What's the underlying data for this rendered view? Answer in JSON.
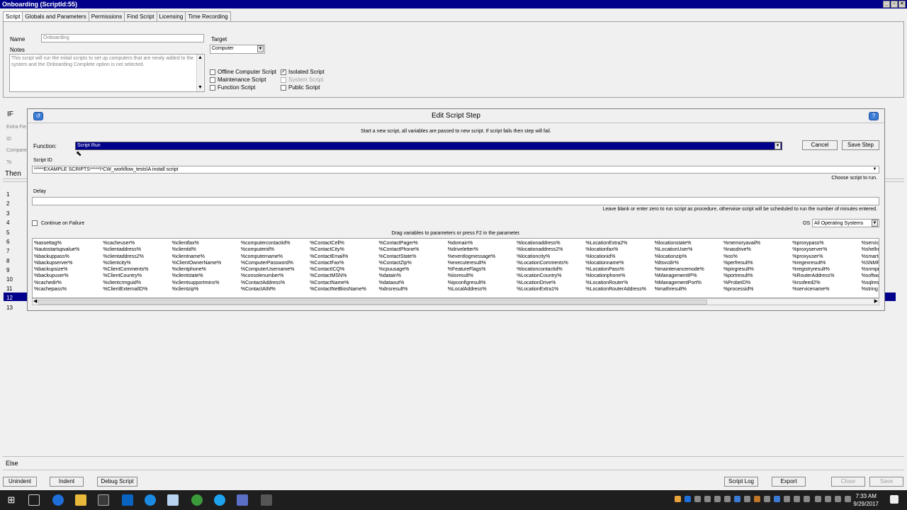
{
  "window": {
    "title": "Onboarding  (ScriptId:55)"
  },
  "tabs": [
    "Script",
    "Globals and Parameters",
    "Permissions",
    "Find Script",
    "Licensing",
    "Time Recording"
  ],
  "script_form": {
    "name_label": "Name",
    "name_value": "Onboarding",
    "notes_label": "Notes",
    "notes_value": "This script will run the initial scripts to set up computers that are newly added to the system and the Onboarding Complete option is not selected.",
    "target_label": "Target",
    "target_value": "Computer",
    "checks": [
      {
        "label": "Offline Computer Script",
        "checked": false,
        "disabled": false
      },
      {
        "label": "Maintenance Script",
        "checked": false,
        "disabled": false
      },
      {
        "label": "Function Script",
        "checked": false,
        "disabled": false
      },
      {
        "label": "Isolated Script",
        "checked": true,
        "disabled": false
      },
      {
        "label": "System Script",
        "checked": false,
        "disabled": true
      },
      {
        "label": "Public Script",
        "checked": false,
        "disabled": false
      }
    ]
  },
  "side": {
    "if_label": "IF",
    "extra_field": "Extra Fie",
    "id_label": "ID",
    "compare_label": "Compare",
    "to_label": "To",
    "then_label": "Then",
    "else_label": "Else",
    "row_numbers": [
      "1",
      "2",
      "3",
      "4",
      "5",
      "6",
      "7",
      "8",
      "9",
      "10",
      "11",
      "12",
      "13"
    ]
  },
  "dialog": {
    "title": "Edit Script Step",
    "description": "Start a new script, all variables are passed to new script. If script fails then step will fail.",
    "function_label": "Function:",
    "function_value": "Script Run",
    "cancel_label": "Cancel",
    "save_step_label": "Save Step",
    "script_id_label": "Script ID",
    "script_id_value": "*****EXAMPLE SCRIPTS*****\\*CW_workflow_tests\\A install script",
    "choose_hint": "Choose script to run.",
    "delay_label": "Delay",
    "delay_value": "",
    "delay_hint": "Leave blank or enter zero to run script as procedure, otherwise script will be scheduled to run the number of minutes entered.",
    "continue_label": "Continue on Failure",
    "os_label": "OS",
    "os_value": "All Operating Systems",
    "drag_hint": "Drag variables to parameters or press F2 in the parameter.",
    "variables": [
      [
        "%assettag%",
        "%autostartupvalue%",
        "%backuppass%",
        "%backupserver%",
        "%backupsize%",
        "%backupuser%",
        "%cachedir%",
        "%cachepass%"
      ],
      [
        "%cacheuser%",
        "%clientaddress%",
        "%clientaddress2%",
        "%clientcity%",
        "%ClientComments%",
        "%ClientCountry%",
        "%clientcrmguid%",
        "%ClientExternalID%"
      ],
      [
        "%clientfax%",
        "%clientid%",
        "%clientname%",
        "%ClientOwnerName%",
        "%clientphone%",
        "%clientstate%",
        "%clientsupportmins%",
        "%clientzip%"
      ],
      [
        "%computercontactid%",
        "%computerid%",
        "%computername%",
        "%ComputerPassword%",
        "%ComputerUsername%",
        "%consolenumber%",
        "%ContactAddress%",
        "%ContactAIM%"
      ],
      [
        "%ContactCell%",
        "%ContactCity%",
        "%ContactEmail%",
        "%ContactFax%",
        "%ContactICQ%",
        "%ContactMSN%",
        "%ContactName%",
        "%ContactNetBiosName%"
      ],
      [
        "%ContactPager%",
        "%ContactPhone%",
        "%ContactState%",
        "%ContactZip%",
        "%cpuusage%",
        "%datain%",
        "%dataout%",
        "%dnsresult%"
      ],
      [
        "%domain%",
        "%driveletter%",
        "%eventlogmessage%",
        "%executeresult%",
        "%FeatureFlags%",
        "%iisresult%",
        "%ipconfigresult%",
        "%LocalAddress%"
      ],
      [
        "%locationaddress%",
        "%locationaddress2%",
        "%locationcity%",
        "%LocationComments%",
        "%locationcontactid%",
        "%LocationCountry%",
        "%LocationDrive%",
        "%LocationExtra1%"
      ],
      [
        "%LocationExtra2%",
        "%locationfax%",
        "%locationid%",
        "%locationname%",
        "%LocationPass%",
        "%locationphone%",
        "%LocationRouter%",
        "%LocationRouterAddress%"
      ],
      [
        "%locationstate%",
        "%LocationUser%",
        "%locationzip%",
        "%ltsvcdir%",
        "%maintenancemode%",
        "%ManagementIP%",
        "%ManagementPort%",
        "%mathresult%"
      ],
      [
        "%memoryavail%",
        "%nasdrive%",
        "%os%",
        "%perfresult%",
        "%pingresult%",
        "%portresult%",
        "%ProbeID%",
        "%processid%"
      ],
      [
        "%proxypass%",
        "%proxyserver%",
        "%proxyuser%",
        "%regexresult%",
        "%registryresult%",
        "%RouterAddress%",
        "%rssfeed2%",
        "%servicename%"
      ],
      [
        "%servic",
        "%shellre",
        "%smartr",
        "%SNMPr",
        "%snmpr",
        "%softwa",
        "%sqlres",
        "%string"
      ]
    ]
  },
  "bottom": {
    "unindent": "Unindent",
    "indent": "Indent",
    "debug": "Debug Script",
    "script_log": "Script Log",
    "export": "Export",
    "close": "Close",
    "save": "Save"
  },
  "taskbar": {
    "time": "7:33 AM",
    "date": "9/29/2017"
  }
}
